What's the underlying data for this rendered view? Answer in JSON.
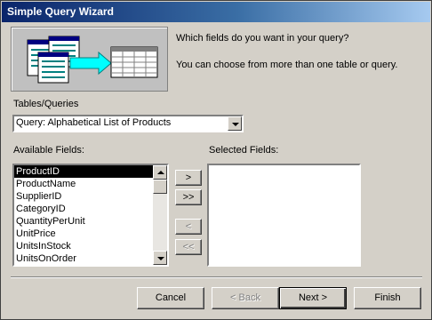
{
  "title": "Simple Query Wizard",
  "prompt": "Which fields do you want in your query?",
  "hint": "You can choose from more than one table or query.",
  "tables_label": "Tables/Queries",
  "tables_value": "Query: Alphabetical List of Products",
  "available_label": "Available Fields:",
  "selected_label": "Selected Fields:",
  "available_fields": [
    "ProductID",
    "ProductName",
    "SupplierID",
    "CategoryID",
    "QuantityPerUnit",
    "UnitPrice",
    "UnitsInStock",
    "UnitsOnOrder"
  ],
  "buttons": {
    "add_one": ">",
    "add_all": ">>",
    "remove_one": "<",
    "remove_all": "<<",
    "cancel": "Cancel",
    "back": "< Back",
    "next": "Next >",
    "finish": "Finish"
  }
}
